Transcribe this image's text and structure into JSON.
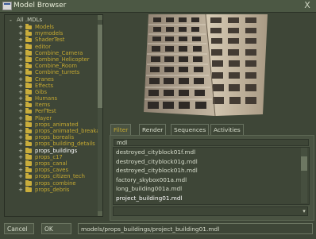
{
  "window": {
    "title": "Model Browser",
    "close_label": "X"
  },
  "tree": {
    "root_label": "All .MDLs",
    "items": [
      {
        "label": "Models",
        "selected": false
      },
      {
        "label": "mymodels",
        "selected": false
      },
      {
        "label": "ShaderTest",
        "selected": false
      },
      {
        "label": "editor",
        "selected": false
      },
      {
        "label": "Combine_Camera",
        "selected": false
      },
      {
        "label": "Combine_Helicopter",
        "selected": false
      },
      {
        "label": "Combine_Room",
        "selected": false
      },
      {
        "label": "Combine_turrets",
        "selected": false
      },
      {
        "label": "Cranes",
        "selected": false
      },
      {
        "label": "Effects",
        "selected": false
      },
      {
        "label": "Gibs",
        "selected": false
      },
      {
        "label": "Humans",
        "selected": false
      },
      {
        "label": "Items",
        "selected": false
      },
      {
        "label": "PerfTest",
        "selected": false
      },
      {
        "label": "Player",
        "selected": false
      },
      {
        "label": "props_animated",
        "selected": false
      },
      {
        "label": "props_animated_breakable",
        "selected": false
      },
      {
        "label": "props_borealis",
        "selected": false
      },
      {
        "label": "props_building_details",
        "selected": false
      },
      {
        "label": "props_buildings",
        "selected": true
      },
      {
        "label": "props_c17",
        "selected": false
      },
      {
        "label": "props_canal",
        "selected": false
      },
      {
        "label": "props_caves",
        "selected": false
      },
      {
        "label": "props_citizen_tech",
        "selected": false
      },
      {
        "label": "props_combine",
        "selected": false
      },
      {
        "label": "props_debris",
        "selected": false
      }
    ]
  },
  "tabs": [
    {
      "label": "Filter",
      "active": true
    },
    {
      "label": "Render",
      "active": false
    },
    {
      "label": "Sequences",
      "active": false
    },
    {
      "label": "Activities",
      "active": false
    }
  ],
  "filter": {
    "value": "mdl"
  },
  "results": [
    {
      "label": "destroyed_cityblock01f.mdl",
      "selected": false
    },
    {
      "label": "destroyed_cityblock01g.mdl",
      "selected": false
    },
    {
      "label": "destroyed_cityblock01h.mdl",
      "selected": false
    },
    {
      "label": "factory_skybox001a.mdl",
      "selected": false
    },
    {
      "label": "long_building001a.mdl",
      "selected": false
    },
    {
      "label": "project_building01.mdl",
      "selected": true
    }
  ],
  "buttons": {
    "cancel": "Cancel",
    "ok": "OK"
  },
  "path": {
    "value": "models/props_buildings/project_building01.mdl"
  },
  "colors": {
    "background": "#3e4637",
    "tree_text": "#c5a931",
    "folder": "#c9ad3c",
    "active_tab_text": "#c5a931"
  }
}
